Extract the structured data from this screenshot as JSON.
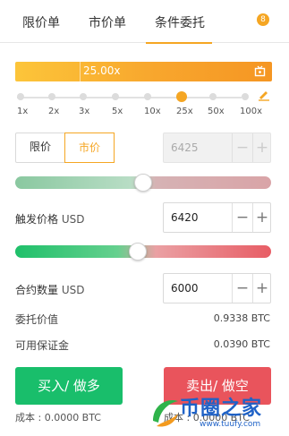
{
  "tabs": [
    {
      "label": "限价单"
    },
    {
      "label": "市价单"
    },
    {
      "label": "条件委托"
    }
  ],
  "tab_badge": "8",
  "leverage": {
    "value": "25.00x",
    "options": [
      "1x",
      "2x",
      "3x",
      "5x",
      "10x",
      "25x",
      "50x",
      "100x"
    ],
    "selected_index": 5
  },
  "order_type": {
    "limit_label": "限价",
    "market_label": "市价",
    "price_placeholder_value": "6425"
  },
  "trigger_price": {
    "label": "触发价格",
    "unit": "USD",
    "value": "6420"
  },
  "quantity": {
    "label": "合约数量",
    "unit": "USD",
    "value": "6000"
  },
  "summary": {
    "order_value_label": "委托价值",
    "order_value": "0.9338 BTC",
    "available_margin_label": "可用保证金",
    "available_margin": "0.0390 BTC"
  },
  "actions": {
    "buy_label": "买入/ 做多",
    "sell_label": "卖出/ 做空"
  },
  "costs": {
    "buy_cost": "成本 : 0.0000 BTC",
    "sell_cost": "成本 : 0.0000 BTC"
  },
  "stepper_symbols": {
    "minus": "−",
    "plus": "+"
  },
  "sliders": {
    "price_slider_fraction": 0.5,
    "quantity_slider_fraction": 0.48
  },
  "watermark": {
    "brand": "币圈之家",
    "url": "www.tuufy.com"
  },
  "colors": {
    "accent": "#f5a623",
    "buy": "#19be6b",
    "sell": "#e9545c",
    "watermark": "#1f62c7"
  }
}
